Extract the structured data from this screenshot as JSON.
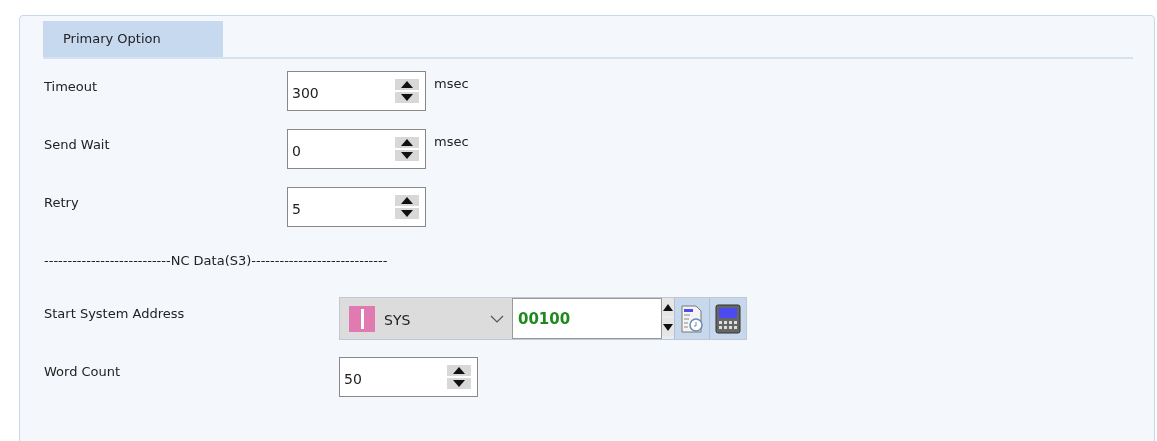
{
  "tabs": [
    {
      "label": "Primary Option",
      "selected": true
    }
  ],
  "primary_fields": [
    {
      "label": "Timeout",
      "value": "300",
      "unit": "msec"
    },
    {
      "label": "Send Wait",
      "value": "0",
      "unit": "msec"
    },
    {
      "label": "Retry",
      "value": "5"
    }
  ],
  "separator": "---------------------------NC Data(S3)-----------------------------",
  "address": {
    "label": "Start System Address",
    "device": "SYS",
    "value": "00100"
  },
  "word_count": {
    "label": "Word Count",
    "value": "50"
  }
}
